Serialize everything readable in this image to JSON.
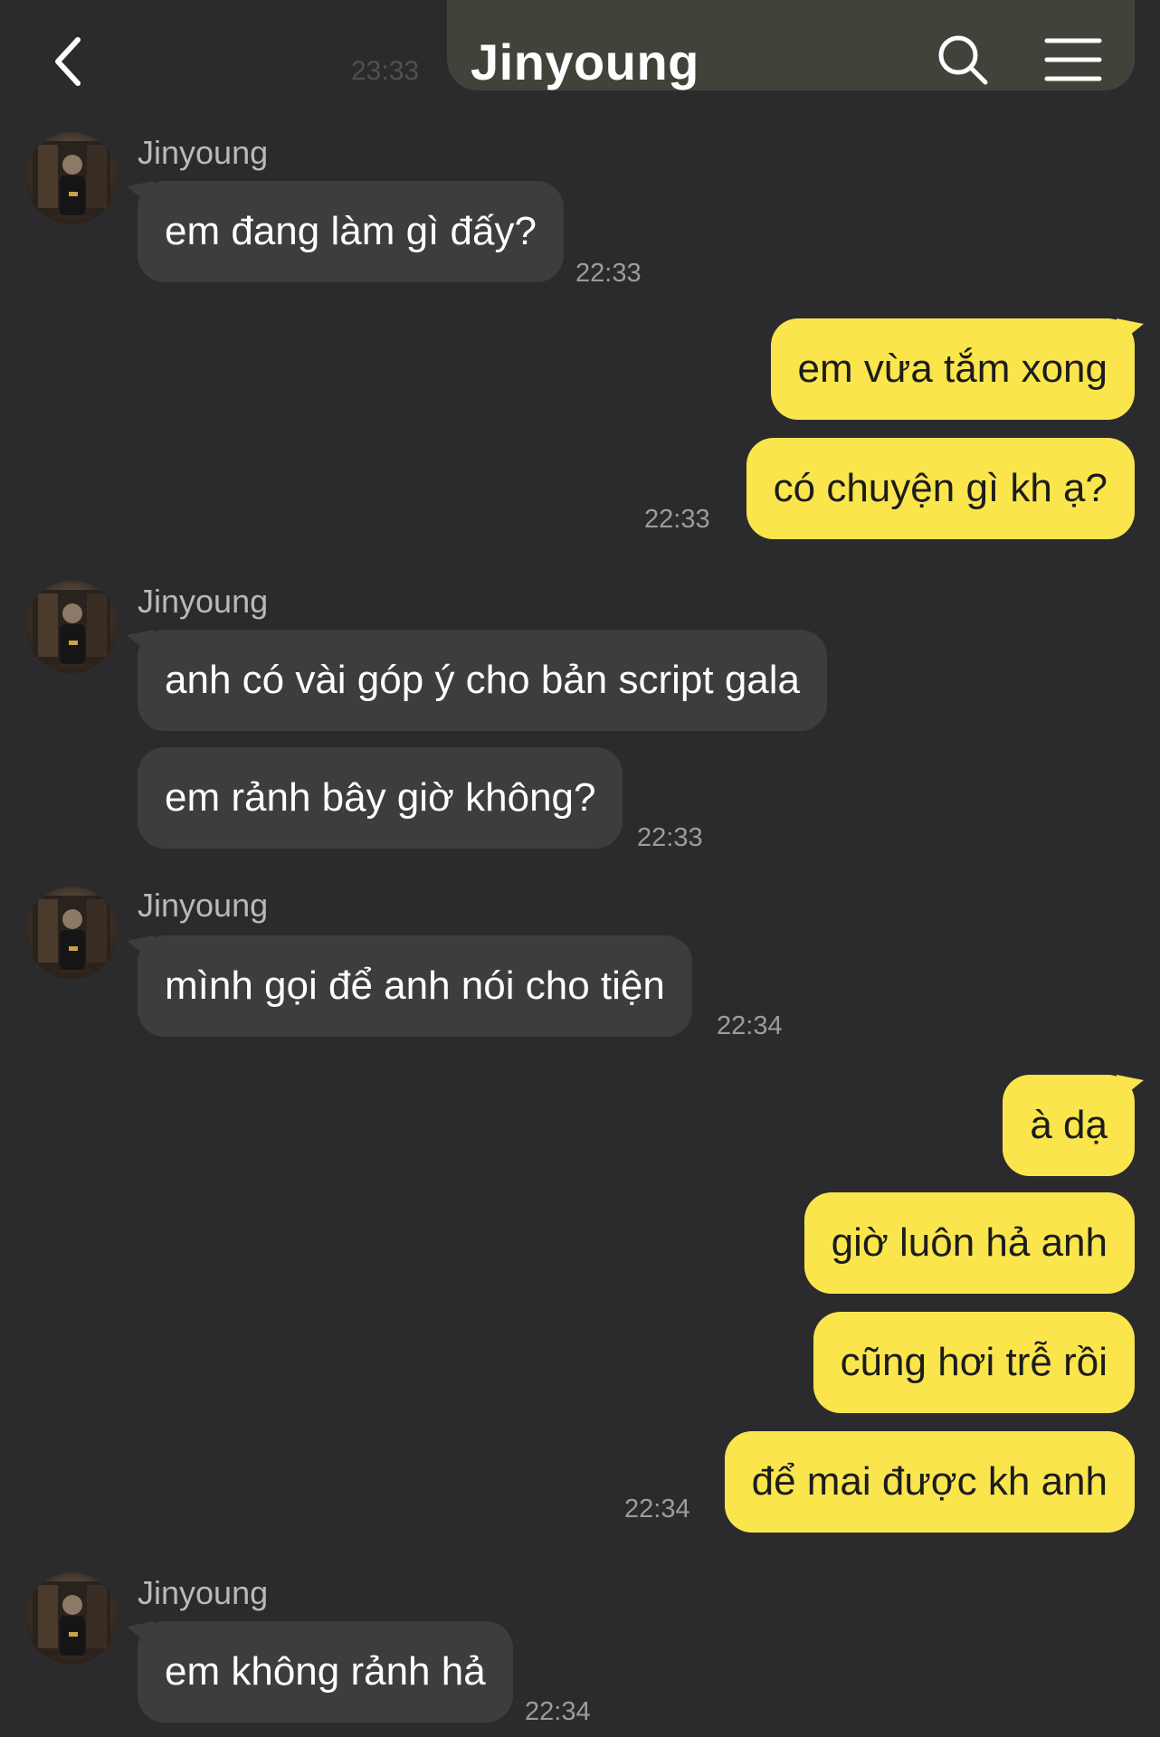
{
  "header": {
    "title": "Jinyoung",
    "back_icon": "chevron-left-icon",
    "search_icon": "search-icon",
    "menu_icon": "menu-icon"
  },
  "ghost_time": "23:33",
  "colors": {
    "background": "#2b2b2d",
    "incoming_bubble": "#3d3d40",
    "outgoing_bubble": "#fae64c",
    "timestamp": "#9c9c9e"
  },
  "messages": {
    "g1": {
      "sender": "Jinyoung",
      "text": [
        "em đang làm gì đấy?"
      ],
      "time": "22:33"
    },
    "g2": {
      "text": [
        "em vừa tắm xong",
        "có chuyện gì kh ạ?"
      ],
      "time": "22:33"
    },
    "g3": {
      "sender": "Jinyoung",
      "text": [
        "anh có vài góp ý cho bản script gala",
        "em rảnh bây giờ không?"
      ],
      "time": "22:33"
    },
    "g4": {
      "sender": "Jinyoung",
      "text": [
        "mình gọi để anh nói cho tiện"
      ],
      "time": "22:34"
    },
    "g5": {
      "text": [
        "à dạ",
        "giờ luôn hả anh",
        "cũng hơi trễ rồi",
        "để mai được kh anh"
      ],
      "time": "22:34"
    },
    "g6": {
      "sender": "Jinyoung",
      "text": [
        "em không rảnh hả"
      ],
      "time": "22:34"
    }
  }
}
